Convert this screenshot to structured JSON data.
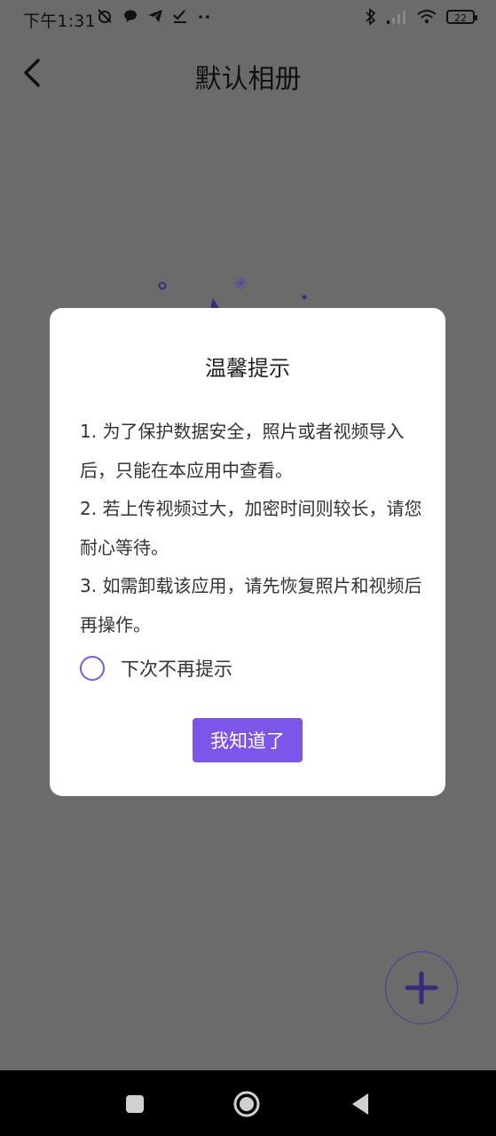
{
  "status_bar": {
    "time": "下午1:31",
    "battery": "22",
    "icons": [
      "alarm-off-icon",
      "chat-bubble-icon",
      "telegram-icon",
      "check-icon",
      "more-dots-icon",
      "bluetooth-icon",
      "signal-icon",
      "wifi-icon",
      "battery-icon"
    ]
  },
  "header": {
    "title": "默认相册",
    "back_icon": "chevron-left-icon"
  },
  "dialog": {
    "title": "温馨提示",
    "lines": [
      "1. 为了保护数据安全，照片或者视频导入后，只能在本应用中查看。",
      "2. 若上传视频过大，加密时间则较长，请您耐心等待。",
      "3. 如需卸载该应用，请先恢复照片和视频后再操作。"
    ],
    "checkbox_label": "下次不再提示",
    "checkbox_checked": false,
    "confirm_label": "我知道了"
  },
  "fab": {
    "icon": "plus-icon"
  },
  "nav_bar": {
    "icons": [
      "recents-square-icon",
      "home-circle-icon",
      "back-triangle-icon"
    ]
  },
  "colors": {
    "accent": "#7b56e8",
    "overlay": "#6b6b6b",
    "dialog_bg": "#ffffff",
    "fab_plus": "#3a2a7a"
  }
}
